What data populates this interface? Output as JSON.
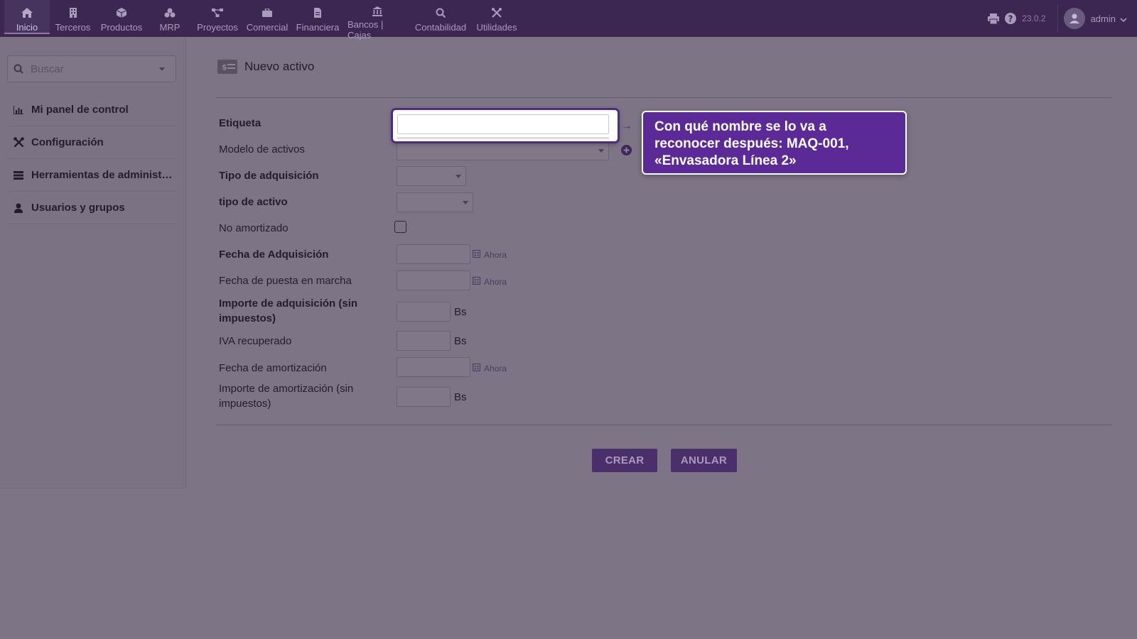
{
  "topnav": {
    "items": [
      {
        "label": "Inicio",
        "icon": "home-icon"
      },
      {
        "label": "Terceros",
        "icon": "building-icon"
      },
      {
        "label": "Productos",
        "icon": "cube-icon"
      },
      {
        "label": "MRP",
        "icon": "cubes-icon"
      },
      {
        "label": "Proyectos",
        "icon": "project-diagram-icon"
      },
      {
        "label": "Comercial",
        "icon": "suitcase-icon"
      },
      {
        "label": "Financiera",
        "icon": "file-invoice-icon"
      },
      {
        "label": "Bancos | Cajas",
        "icon": "bank-icon"
      },
      {
        "label": "Contabilidad",
        "icon": "search-dollar-icon"
      },
      {
        "label": "Utilidades",
        "icon": "tools-icon"
      }
    ],
    "active": "Inicio"
  },
  "topright": {
    "version": "23.0.2",
    "user": "admin"
  },
  "sidebar": {
    "search_placeholder": "Buscar",
    "items": [
      {
        "label": "Mi panel de control",
        "icon": "chart-icon"
      },
      {
        "label": "Configuración",
        "icon": "tools-icon"
      },
      {
        "label": "Herramientas de administ…",
        "icon": "server-icon"
      },
      {
        "label": "Usuarios y grupos",
        "icon": "user-icon"
      }
    ]
  },
  "page": {
    "title": "Nuevo activo"
  },
  "form": {
    "etiqueta": "Etiqueta",
    "modelo": "Modelo de activos",
    "tipo_adquisicion": "Tipo de adquisición",
    "tipo_activo": "tipo de activo",
    "no_amortizado": "No amortizado",
    "fecha_adquisicion": "Fecha de Adquisición",
    "fecha_puesta": "Fecha de puesta en marcha",
    "importe_adquisicion": "Importe de adquisición (sin impuestos)",
    "iva": "IVA recuperado",
    "fecha_amortizacion": "Fecha de amortización",
    "importe_amortizacion": "Importe de amortización (sin impuestos)",
    "now_label": "Ahora",
    "currency": "Bs"
  },
  "buttons": {
    "create": "CREAR",
    "cancel": "ANULAR"
  },
  "tooltip": {
    "text": "Con qué nombre se lo va a reconocer después: MAQ-001, «Envasadora Línea 2»"
  },
  "colors": {
    "topbar": "#3b2752",
    "accent": "#5b2a97",
    "overlay": "#7d7586"
  }
}
